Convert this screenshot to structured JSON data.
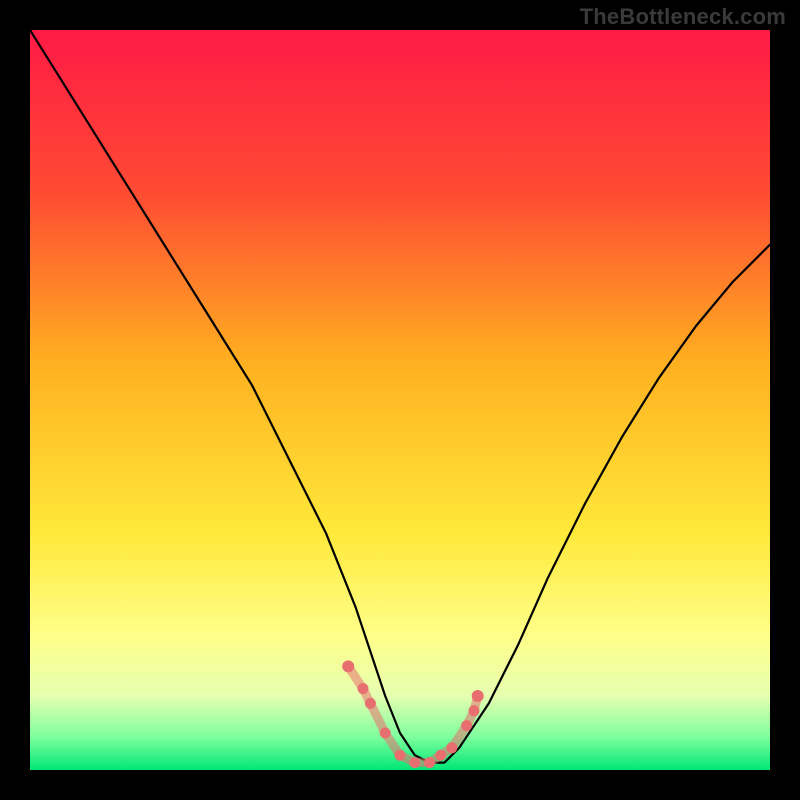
{
  "watermark": "TheBottleneck.com",
  "colors": {
    "frame": "#000000",
    "gradient_top": "#ff1a46",
    "gradient_mid1": "#ff7a2a",
    "gradient_mid2": "#ffd21f",
    "gradient_mid3": "#ffff60",
    "gradient_mid4": "#e9ff9a",
    "gradient_bottom_green": "#00e676",
    "curve": "#000000",
    "dots": "#e86f6f"
  },
  "chart_data": {
    "type": "line",
    "title": "",
    "xlabel": "",
    "ylabel": "",
    "xlim": [
      0,
      100
    ],
    "ylim": [
      0,
      100
    ],
    "series": [
      {
        "name": "bottleneck curve",
        "x": [
          0,
          5,
          10,
          15,
          20,
          25,
          30,
          35,
          40,
          44,
          48,
          50,
          52,
          54,
          56,
          58,
          62,
          66,
          70,
          75,
          80,
          85,
          90,
          95,
          100
        ],
        "y": [
          100,
          92,
          84,
          76,
          68,
          60,
          52,
          42,
          32,
          22,
          10,
          5,
          2,
          1,
          1,
          3,
          9,
          17,
          26,
          36,
          45,
          53,
          60,
          66,
          71
        ]
      }
    ],
    "marker_points": {
      "name": "highlighted dots",
      "x": [
        43,
        45,
        46,
        48,
        50,
        52,
        54,
        55.5,
        57,
        59,
        60,
        60.5
      ],
      "y": [
        14,
        11,
        9,
        5,
        2,
        1,
        1,
        2,
        3,
        6,
        8,
        10
      ]
    },
    "gradient_stops": [
      {
        "offset": 0.0,
        "color": "#ff1a46"
      },
      {
        "offset": 0.22,
        "color": "#ff4b33"
      },
      {
        "offset": 0.45,
        "color": "#ffb020"
      },
      {
        "offset": 0.68,
        "color": "#ffe93a"
      },
      {
        "offset": 0.82,
        "color": "#ffff8a"
      },
      {
        "offset": 0.9,
        "color": "#e6ffb0"
      },
      {
        "offset": 0.955,
        "color": "#7fff9e"
      },
      {
        "offset": 1.0,
        "color": "#00e676"
      }
    ]
  }
}
